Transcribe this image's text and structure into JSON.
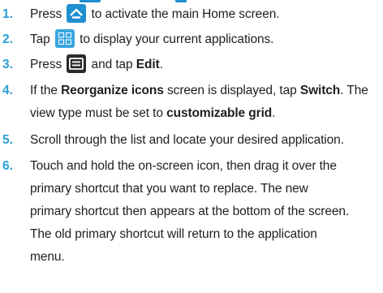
{
  "steps": [
    {
      "num": "1.",
      "pre": "Press ",
      "icon": "home-icon",
      "post": " to activate the main Home screen."
    },
    {
      "num": "2.",
      "pre": "Tap ",
      "icon": "apps-icon",
      "post": " to display your current applications."
    },
    {
      "num": "3.",
      "pre": "Press ",
      "icon": "menu-icon",
      "mid": " and tap ",
      "bold1": "Edit",
      "post": "."
    },
    {
      "num": "4.",
      "l1_pre": "If the ",
      "l1_bold1": "Reorganize icons",
      "l1_mid": " screen is displayed, tap ",
      "l1_bold2": "Switch",
      "l1_post": ". The",
      "l2_pre": "view type must be set to ",
      "l2_bold": "customizable grid",
      "l2_post": "."
    },
    {
      "num": "5.",
      "text": "Scroll through the list and locate your desired application."
    },
    {
      "num": "6.",
      "lines": [
        "Touch and hold the on-screen icon, then drag it over the",
        "primary shortcut that you want to replace. The new",
        "primary shortcut then appears at the bottom of the screen.",
        "The old primary shortcut will return to the application",
        "menu."
      ]
    }
  ],
  "colors": {
    "step_number": "#2a9fd6",
    "icon_blue": "#1e8fd0",
    "icon_dark": "#2a2a2a"
  }
}
